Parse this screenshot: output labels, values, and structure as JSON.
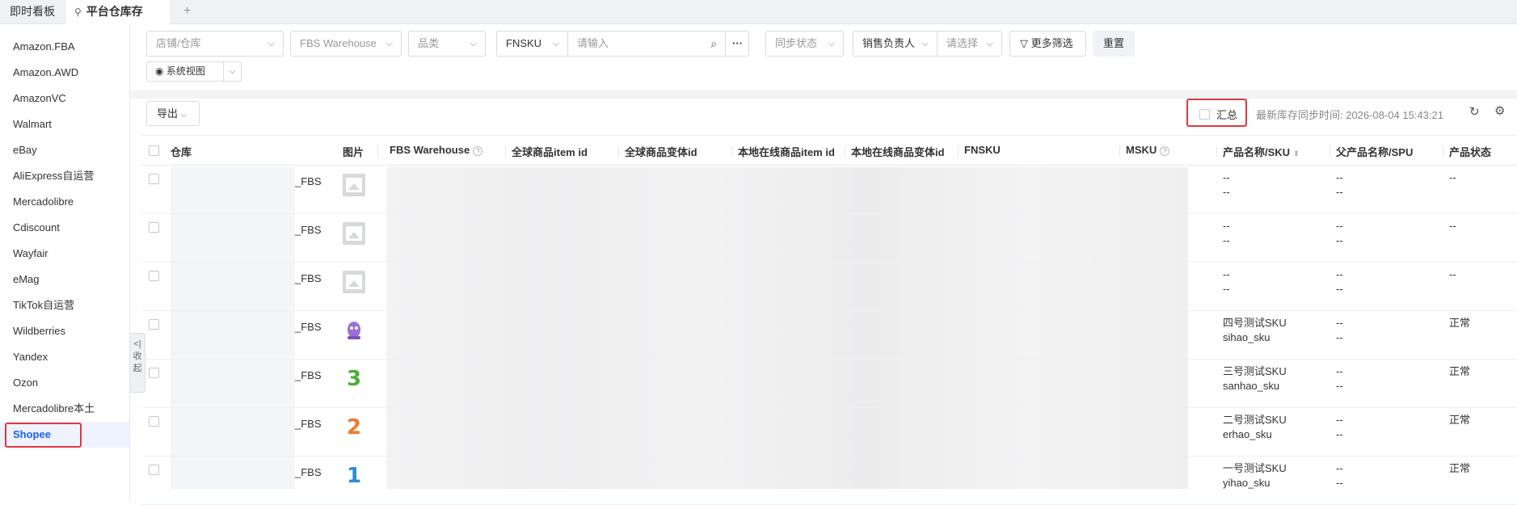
{
  "tabs": {
    "t1": "即时看板",
    "t2": "平台仓库存",
    "plus": "+"
  },
  "sidebar": {
    "items": [
      {
        "label": "Amazon.FBA"
      },
      {
        "label": "Amazon.AWD"
      },
      {
        "label": "AmazonVC"
      },
      {
        "label": "Walmart"
      },
      {
        "label": "eBay"
      },
      {
        "label": "AliExpress自运营"
      },
      {
        "label": "Mercadolibre"
      },
      {
        "label": "Cdiscount"
      },
      {
        "label": "Wayfair"
      },
      {
        "label": "eMag"
      },
      {
        "label": "TikTok自运营"
      },
      {
        "label": "Wildberries"
      },
      {
        "label": "Yandex"
      },
      {
        "label": "Ozon"
      },
      {
        "label": "Mercadolibre本土"
      },
      {
        "label": "Shopee"
      }
    ],
    "collapse_label": "<| 收 起"
  },
  "filters": {
    "store": "店铺/仓库",
    "warehouse": "FBS Warehouse",
    "category": "品类",
    "fnsku": "FNSKU",
    "search_placeholder": "请输入",
    "more_dots": "···",
    "sync_status": "同步状态",
    "salesperson": "销售负责人",
    "select_placeholder": "请选择",
    "more_filter": "更多筛选",
    "reset": "重置",
    "system_view": "系统视图"
  },
  "toolbar": {
    "export": "导出",
    "summary": "汇总",
    "sync_time": "最新库存同步时间: 2026-08-04 15:43:21"
  },
  "table": {
    "headers": {
      "warehouse": "仓库",
      "image": "图片",
      "fbs": "FBS Warehouse",
      "global_item": "全球商品item id",
      "global_var": "全球商品变体id",
      "local_item": "本地在线商品item id",
      "local_var": "本地在线商品变体id",
      "fnsku": "FNSKU",
      "msku": "MSKU",
      "name_sku": "产品名称/SKU",
      "parent": "父产品名称/SPU",
      "status": "产品状态"
    },
    "rows": [
      {
        "wh": "_FBS",
        "name": "--",
        "sku": "--",
        "parent1": "--",
        "parent2": "--",
        "status": "--",
        "img": "placeholder"
      },
      {
        "wh": "_FBS",
        "name": "--",
        "sku": "--",
        "parent1": "--",
        "parent2": "--",
        "status": "--",
        "img": "placeholder"
      },
      {
        "wh": "_FBS",
        "name": "--",
        "sku": "--",
        "parent1": "--",
        "parent2": "--",
        "status": "--",
        "img": "placeholder"
      },
      {
        "wh": "_FBS",
        "name": "四号测试SKU",
        "sku": "sihao_sku",
        "parent1": "--",
        "parent2": "--",
        "status": "正常",
        "img": "four"
      },
      {
        "wh": "_FBS",
        "name": "三号测试SKU",
        "sku": "sanhao_sku",
        "parent1": "--",
        "parent2": "--",
        "status": "正常",
        "img": "3"
      },
      {
        "wh": "_FBS",
        "name": "二号测试SKU",
        "sku": "erhao_sku",
        "parent1": "--",
        "parent2": "--",
        "status": "正常",
        "img": "2"
      },
      {
        "wh": "_FBS",
        "name": "一号测试SKU",
        "sku": "yihao_sku",
        "parent1": "--",
        "parent2": "--",
        "status": "正常",
        "img": "1"
      }
    ]
  }
}
